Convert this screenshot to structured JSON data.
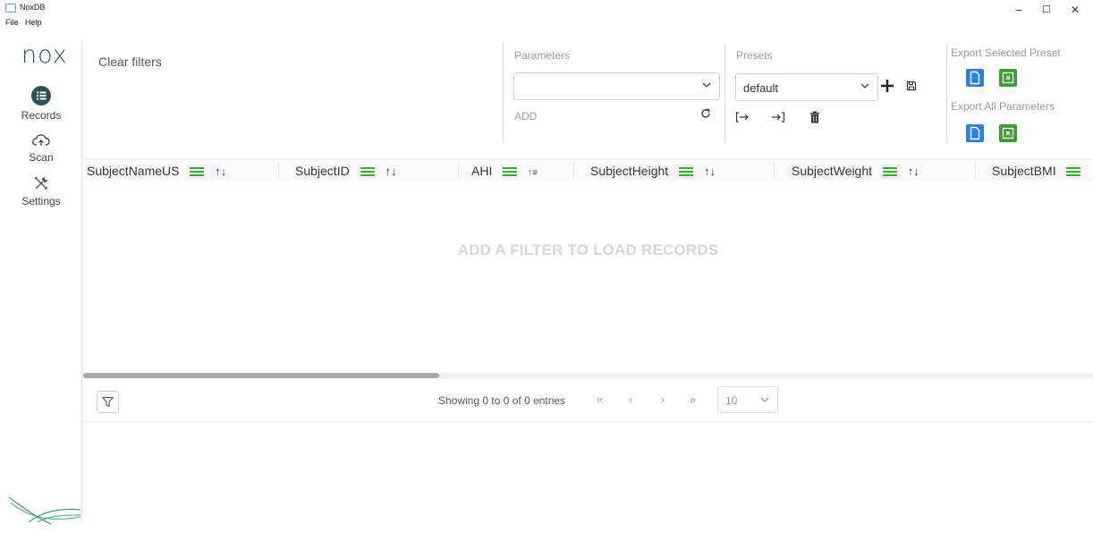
{
  "window": {
    "title": "NoxDB",
    "minimize": "–",
    "maximize": "☐",
    "close": "✕"
  },
  "menu": {
    "items": [
      "File",
      "Help"
    ]
  },
  "sidebar": {
    "logo": "nox",
    "items": [
      {
        "label": "Records",
        "icon": "list-icon"
      },
      {
        "label": "Scan",
        "icon": "cloud-upload-icon"
      },
      {
        "label": "Settings",
        "icon": "tools-icon"
      }
    ]
  },
  "toolbar": {
    "clear_filters": "Clear filters",
    "parameters": {
      "label": "Parameters",
      "value": "",
      "add_label": "ADD"
    },
    "presets": {
      "label": "Presets",
      "value": "default"
    },
    "export_selected_label": "Export Selected Preset",
    "export_all_label": "Export All Parameters"
  },
  "table": {
    "columns": [
      "SubjectNameUS",
      "SubjectID",
      "AHI",
      "SubjectHeight",
      "SubjectWeight",
      "SubjectBMI"
    ],
    "empty_message": "ADD A FILTER TO LOAD RECORDS"
  },
  "footer": {
    "showing": "Showing 0 to 0 of 0 entries",
    "first": "«",
    "prev": "‹",
    "next": "›",
    "last": "»",
    "page_size": "10"
  },
  "colors": {
    "accent_green": "#3aaa35",
    "export_blue": "#2d7fe0",
    "export_green": "#3f9c35"
  }
}
